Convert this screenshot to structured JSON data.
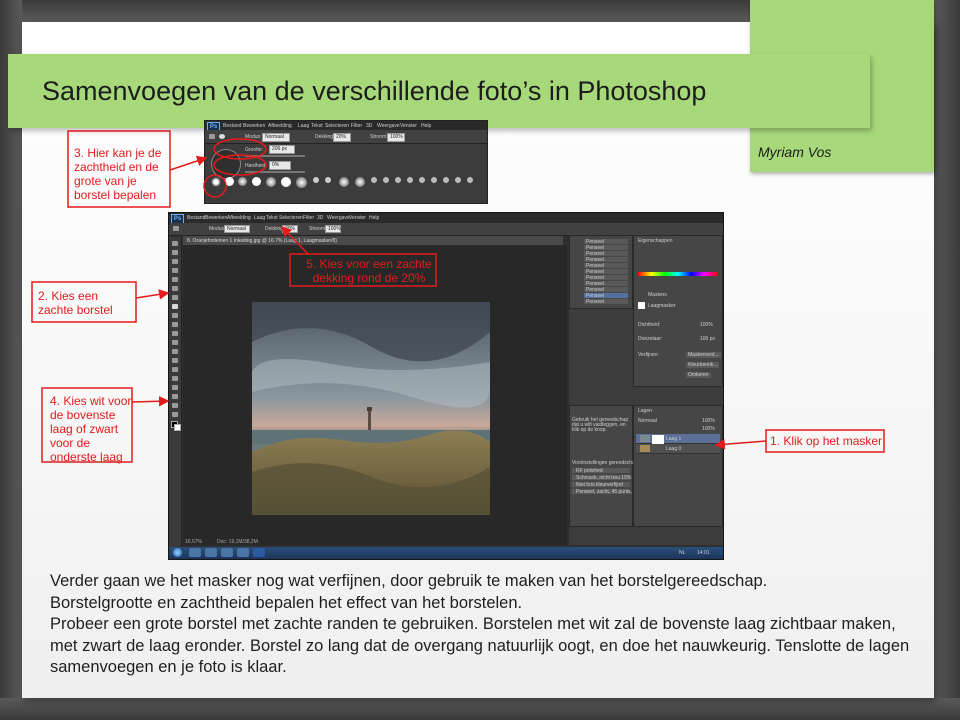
{
  "slide": {
    "title": "Samenvoegen van de verschillende foto’s in Photoshop",
    "author": "Myriam Vos"
  },
  "annotations": {
    "a1": "1. Klik op het masker",
    "a2": "2. Kies een zachte borstel",
    "a3": "3. Hier kan je de zachtheid en de grote van je borstel bepalen",
    "a4": "4. Kies wit voor de bovenste laag of zwart voor de onderste laag",
    "a5": "5. Kies voor een zachte dekking rond de 20%"
  },
  "body": {
    "p1": "Verder gaan we het masker nog wat verfijnen, door gebruik te maken van het borstelgereedschap.",
    "p2": "Borstelgrootte en zachtheid bepalen het effect van het borstelen.",
    "p3": "Probeer een grote borstel met zachte randen te gebruiken. Borstelen met wit zal de bovenste laag zichtbaar maken, met zwart de laag eronder. Borstel zo lang dat de overgang natuurlijk oogt, en doe het nauwkeurig. Tenslotte de lagen samenvoegen en je foto is klaar."
  },
  "photoshop": {
    "logo": "Ps",
    "menu": [
      "Bestand",
      "Bewerken",
      "Afbeelding",
      "Laag",
      "Tekst",
      "Selecteren",
      "Filter",
      "3D",
      "Weergave",
      "Venster",
      "Help"
    ],
    "options": {
      "mode_label": "Modus:",
      "mode_value": "Normaal",
      "opacity_label": "Dekking:",
      "opacity_value": "20%",
      "flow_label": "Stroom:",
      "flow_value": "100%"
    },
    "brush_popup": {
      "size_label": "Grootte:",
      "size_value": "206 px",
      "hardness_label": "Hardheid:",
      "hardness_value": "0%"
    },
    "document_tab": "8. Oranjefonteinen 1 Inleiding.jpg @ 16.7% (Laag 1, Laagmasker/8)",
    "history_items": [
      "Penseel",
      "Penseel",
      "Penseel",
      "Penseel",
      "Penseel",
      "Penseel",
      "Penseel",
      "Penseel",
      "Penseel",
      "Penseel",
      "Penseel"
    ],
    "properties": {
      "title": "Eigenschappen",
      "masks_label": "Maskers",
      "layer_mask_label": "Laagmasker",
      "density_label": "Dichtheid:",
      "density_value": "100%",
      "feather_label": "Doezelaar:",
      "feather_value": "100 px",
      "refine_label": "Verfijnen:",
      "refine_button": "Maskerrand...",
      "color_button": "Kleurbereik...",
      "invert_button": "Omkeren"
    },
    "layers": {
      "title": "Lagen",
      "blend": "Normaal",
      "opacity": "100%",
      "fill": "100%",
      "items": [
        "Laag 1",
        "Laag 0"
      ]
    },
    "actions": {
      "title": "Voorinstellingen gereedschap",
      "items": [
        "RF polished",
        "Schmuck, nicht treu 10% drie",
        "Niet foto kleurverfijnd",
        "Penseel, zacht, 45 punts, rke"
      ]
    },
    "panel_message": "Gebruik het gereedschap dat u wilt vastleggen, en klik op de knop.",
    "status_zoom": "16,67%",
    "status_doc": "Doc: 19,1M/38,2M",
    "taskbar_lang": "NL",
    "taskbar_time": "14:01"
  },
  "colors": {
    "title_band": "#a7d97a",
    "annotation_red": "#e31b1b",
    "ps_dark": "#2f2f2f"
  }
}
